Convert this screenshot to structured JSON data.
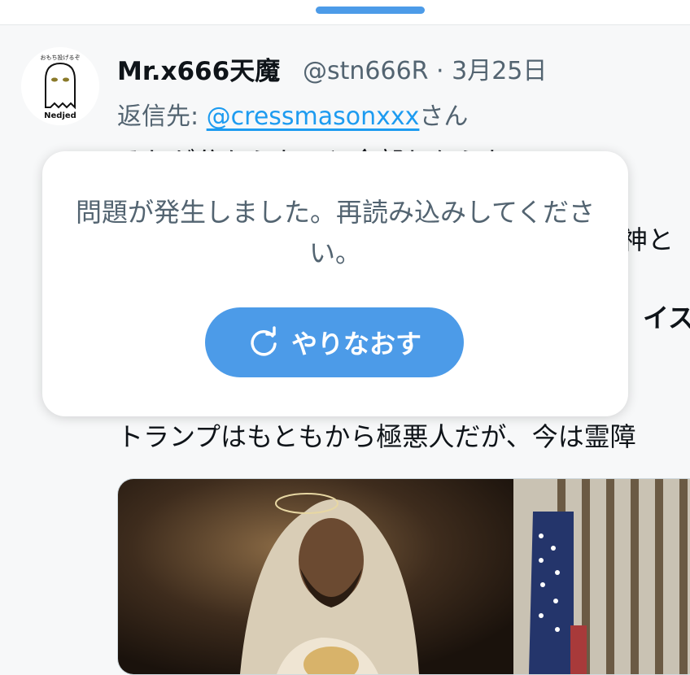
{
  "tweet": {
    "author": {
      "display_name": "Mr.x666天魔",
      "avatar_caption": "Nedjed",
      "avatar_top_text": "おもち投げるぞ"
    },
    "meta": "@stn666R · 3月25日",
    "reply": {
      "prefix": "返信先: ",
      "mention": "@cressmasonxxx",
      "suffix": "さん"
    },
    "lines": [
      "それが分からないと全部わからない",
      "は神と",
      "イス",
      "トランプはもともから極悪人だが、今は霊障"
    ]
  },
  "error_dialog": {
    "message": "問題が発生しました。再読み込みしてください。",
    "retry_label": "やりなおす"
  },
  "colors": {
    "accent": "#4c9be8",
    "link": "#1d9bf0",
    "secondary_text": "#536471"
  }
}
